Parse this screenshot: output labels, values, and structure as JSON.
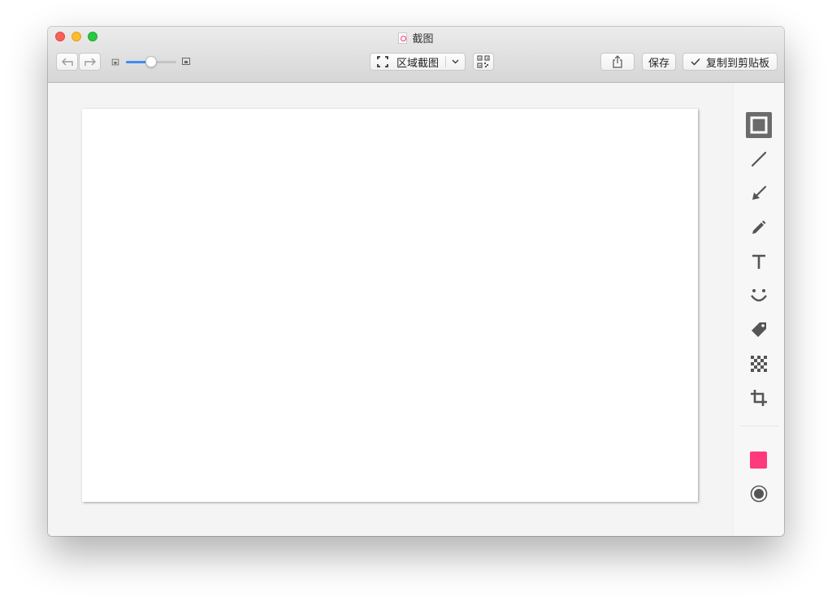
{
  "window": {
    "title": "截图"
  },
  "toolbar": {
    "capture_mode_label": "区域截图",
    "save_label": "保存",
    "copy_label": "复制到剪贴板",
    "zoom_slider_value": 0.5
  },
  "sidebar": {
    "tools": [
      {
        "icon": "rectangle-icon",
        "active": true
      },
      {
        "icon": "line-icon",
        "active": false
      },
      {
        "icon": "arrow-icon",
        "active": false
      },
      {
        "icon": "pencil-icon",
        "active": false
      },
      {
        "icon": "text-icon",
        "active": false
      },
      {
        "icon": "emoji-icon",
        "active": false
      },
      {
        "icon": "tag-icon",
        "active": false
      },
      {
        "icon": "mosaic-icon",
        "active": false
      },
      {
        "icon": "crop-icon",
        "active": false
      }
    ],
    "color": "#ff3a7c",
    "stroke_icon": "stroke-width-icon"
  },
  "colors": {
    "accent": "#3f8cf5",
    "active_tool_bg": "#6b6b6b",
    "icon_gray": "#555555"
  }
}
